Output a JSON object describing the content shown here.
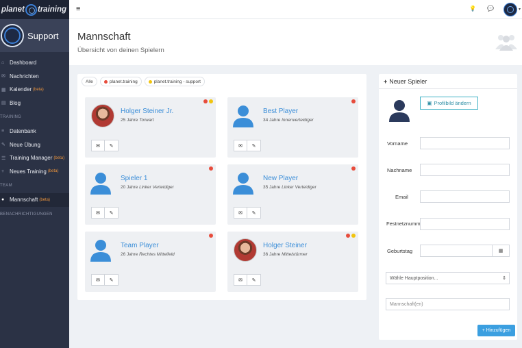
{
  "brand": {
    "name": "planet",
    "name_suffix": "training"
  },
  "support": {
    "label": "Support"
  },
  "sidebar": {
    "items": [
      {
        "label": "Dashboard",
        "icon": "home-icon"
      },
      {
        "label": "Nachrichten",
        "icon": "mail-icon"
      },
      {
        "label": "Kalender",
        "icon": "calendar-icon",
        "beta": "(beta)"
      },
      {
        "label": "Blog",
        "icon": "blog-icon"
      }
    ],
    "section_training": "TRAINING",
    "training_items": [
      {
        "label": "Datenbank",
        "icon": "database-icon"
      },
      {
        "label": "Neue Übung",
        "icon": "pencil-icon"
      },
      {
        "label": "Training Manager",
        "icon": "list-icon",
        "beta": "(beta)"
      },
      {
        "label": "Neues Training",
        "icon": "plus-icon",
        "beta": "(beta)"
      }
    ],
    "section_team": "TEAM",
    "team_items": [
      {
        "label": "Mannschaft",
        "icon": "users-icon",
        "beta": "(beta)"
      }
    ],
    "section_notifications": "BENACHRICHTIGUNGEN"
  },
  "header": {
    "title": "Mannschaft",
    "subtitle": "Übersicht von deinen Spielern"
  },
  "filters": [
    {
      "label": "Alle"
    },
    {
      "label": "planet.training",
      "color": "#e74c3c"
    },
    {
      "label": "planet.training - support",
      "color": "#f1c40f"
    }
  ],
  "players": [
    {
      "name": "Holger Steiner Jr.",
      "age": "25 Jahre",
      "position": "Torwart",
      "photo": true,
      "dots": [
        "#e74c3c",
        "#f1c40f"
      ]
    },
    {
      "name": "Best Player",
      "age": "34 Jahre",
      "position": "Innenverteidiger",
      "photo": false,
      "dots": [
        "#e74c3c"
      ]
    },
    {
      "name": "Spieler 1",
      "age": "20 Jahre",
      "position": "Linker Verteidiger",
      "photo": false,
      "dots": [
        "#e74c3c"
      ]
    },
    {
      "name": "New Player",
      "age": "35 Jahre",
      "position": "Linker Verteidiger",
      "photo": false,
      "dots": [
        "#e74c3c"
      ]
    },
    {
      "name": "Team Player",
      "age": "26 Jahre",
      "position": "Rechtes Mittelfeld",
      "photo": false,
      "dots": [
        "#e74c3c"
      ]
    },
    {
      "name": "Holger Steiner",
      "age": "36 Jahre",
      "position": "Mittelstürmer",
      "photo": true,
      "dots": [
        "#e74c3c",
        "#f1c40f"
      ]
    }
  ],
  "new_player": {
    "title": "Neuer Spieler",
    "profile_button": "Profilbild ändern",
    "labels": {
      "first_name": "Vorname",
      "last_name": "Nachname",
      "email": "Email",
      "landline": "Festnetznumm",
      "birthday": "Geburtstag"
    },
    "position_select": "Wähle Hauptposition...",
    "team_placeholder": "Mannschaft(en)",
    "submit": "+ Hinzufügen"
  },
  "colors": {
    "accent": "#3b8ed8",
    "sidebar": "#2b3245",
    "status_red": "#e74c3c",
    "status_yellow": "#f1c40f"
  }
}
